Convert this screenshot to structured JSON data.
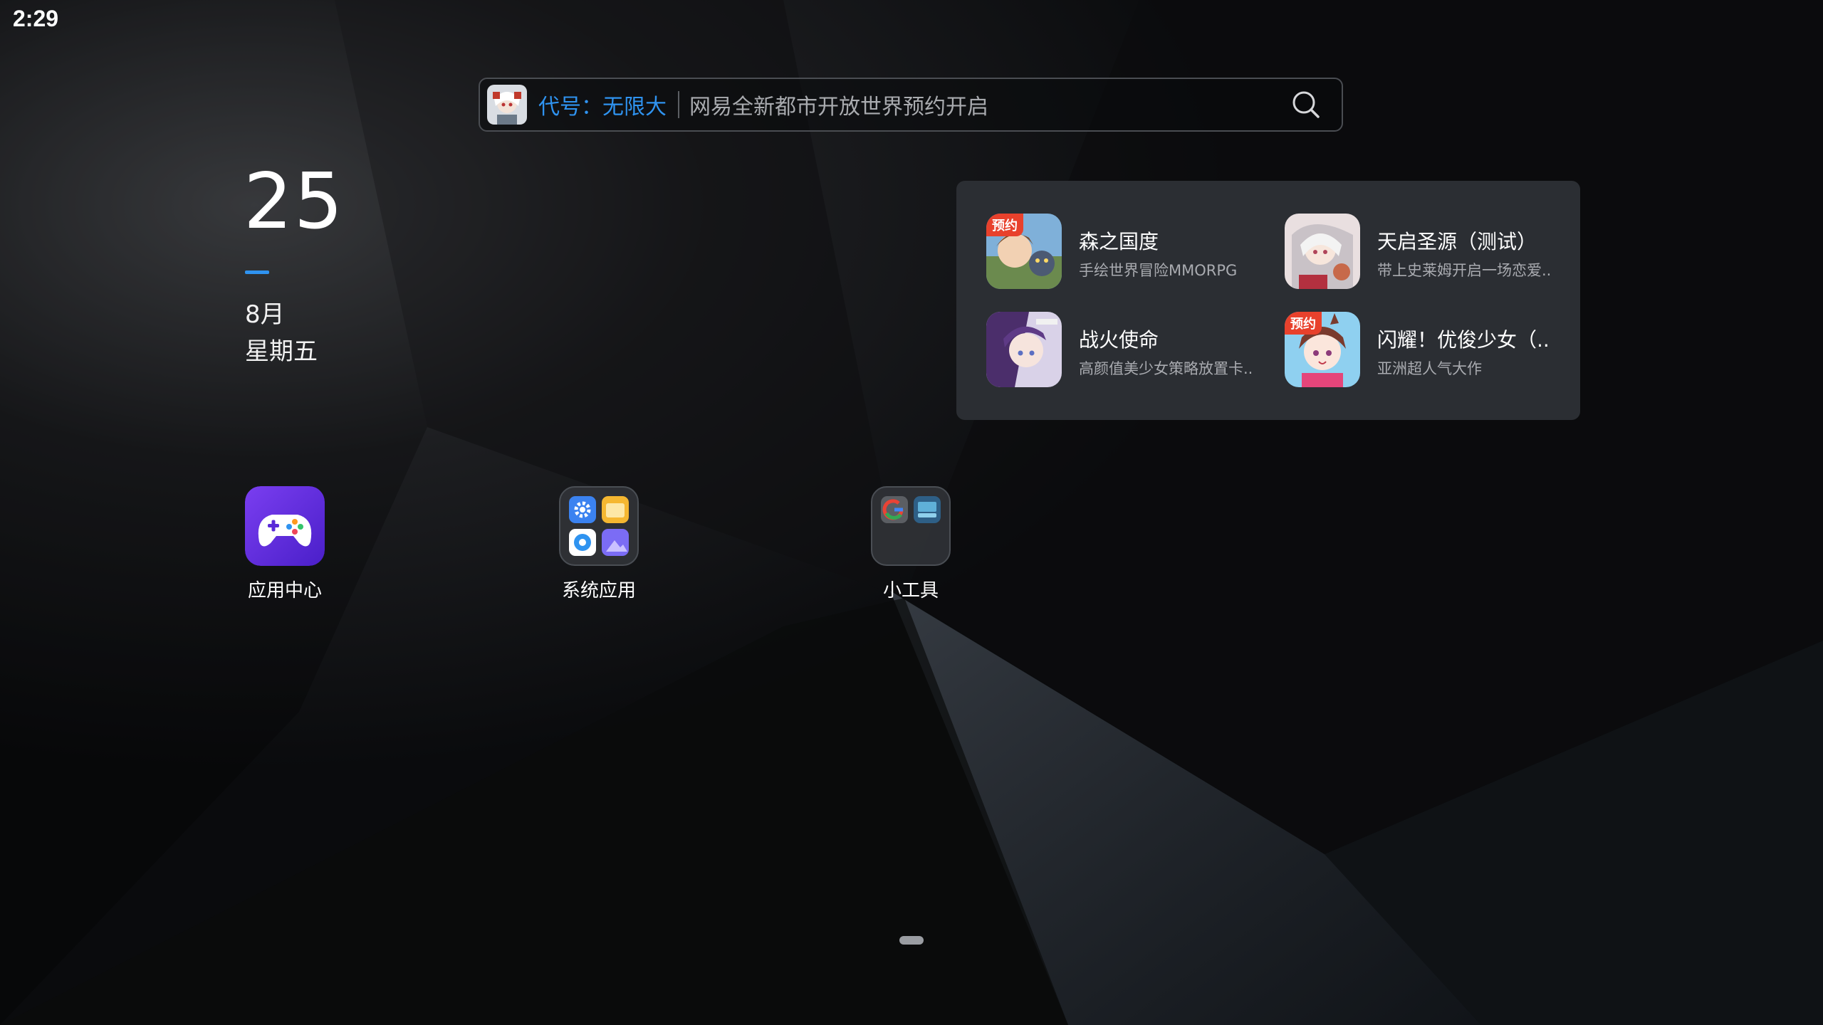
{
  "status_bar": {
    "time": "2:29"
  },
  "search": {
    "highlight": "代号：无限大",
    "text": "网易全新都市开放世界预约开启",
    "accent_color": "#2f93f0",
    "icon": "search-icon"
  },
  "date_widget": {
    "day": "25",
    "month": "8月",
    "weekday": "星期五"
  },
  "recommendations": [
    {
      "title": "森之国度",
      "subtitle": "手绘世界冒险MMORPG",
      "badge": "预约"
    },
    {
      "title": "天启圣源（测试）",
      "subtitle": "带上史莱姆开启一场恋爱...",
      "badge": ""
    },
    {
      "title": "战火使命",
      "subtitle": "高颜值美少女策略放置卡...",
      "badge": ""
    },
    {
      "title": "闪耀！优俊少女（...",
      "subtitle": "亚洲超人气大作",
      "badge": "预约"
    }
  ],
  "apps": [
    {
      "label": "应用中心",
      "icon": "gamepad-icon"
    },
    {
      "label": "系统应用",
      "icon": "system-apps-folder-icon"
    },
    {
      "label": "小工具",
      "icon": "tools-folder-icon"
    }
  ]
}
